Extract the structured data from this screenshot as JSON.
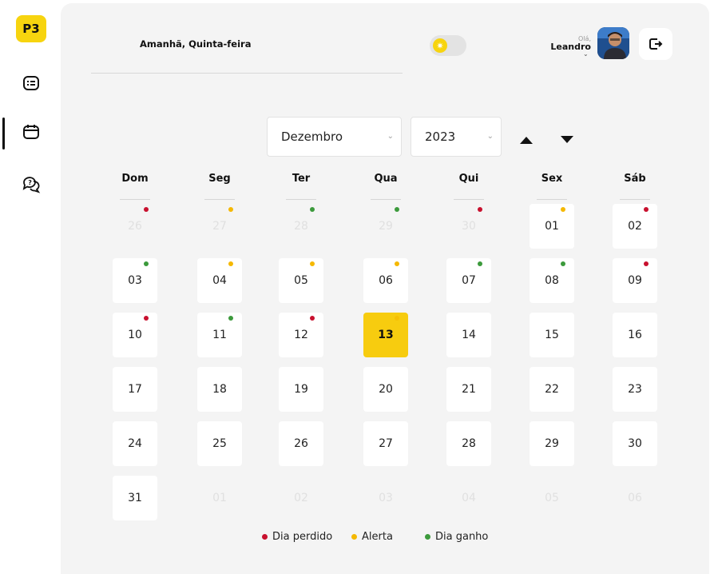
{
  "sidebar": {
    "logo": "P3",
    "items": [
      {
        "icon": "checklist-icon"
      },
      {
        "icon": "calendar-icon"
      },
      {
        "icon": "help-chat-icon"
      }
    ]
  },
  "header": {
    "date_label": "Amanhã, Quinta-feira",
    "greeting": "Olá,",
    "user_name": "Leandro"
  },
  "calendar": {
    "month": "Dezembro",
    "year": "2023",
    "weekdays": [
      "Dom",
      "Seg",
      "Ter",
      "Qua",
      "Qui",
      "Sex",
      "Sáb"
    ],
    "days": [
      {
        "label": "26",
        "other": true,
        "dot": "red"
      },
      {
        "label": "27",
        "other": true,
        "dot": "yellow"
      },
      {
        "label": "28",
        "other": true,
        "dot": "green"
      },
      {
        "label": "29",
        "other": true,
        "dot": "green"
      },
      {
        "label": "30",
        "other": true,
        "dot": "red"
      },
      {
        "label": "01",
        "other": false,
        "dot": "yellow"
      },
      {
        "label": "02",
        "other": false,
        "dot": "red"
      },
      {
        "label": "03",
        "other": false,
        "dot": "green"
      },
      {
        "label": "04",
        "other": false,
        "dot": "yellow"
      },
      {
        "label": "05",
        "other": false,
        "dot": "yellow"
      },
      {
        "label": "06",
        "other": false,
        "dot": "yellow"
      },
      {
        "label": "07",
        "other": false,
        "dot": "green"
      },
      {
        "label": "08",
        "other": false,
        "dot": "green"
      },
      {
        "label": "09",
        "other": false,
        "dot": "red"
      },
      {
        "label": "10",
        "other": false,
        "dot": "red"
      },
      {
        "label": "11",
        "other": false,
        "dot": "green"
      },
      {
        "label": "12",
        "other": false,
        "dot": "red"
      },
      {
        "label": "13",
        "other": false,
        "today": true,
        "dot": "yellow"
      },
      {
        "label": "14",
        "other": false
      },
      {
        "label": "15",
        "other": false
      },
      {
        "label": "16",
        "other": false
      },
      {
        "label": "17",
        "other": false
      },
      {
        "label": "18",
        "other": false
      },
      {
        "label": "19",
        "other": false
      },
      {
        "label": "20",
        "other": false
      },
      {
        "label": "21",
        "other": false
      },
      {
        "label": "22",
        "other": false
      },
      {
        "label": "23",
        "other": false
      },
      {
        "label": "24",
        "other": false
      },
      {
        "label": "25",
        "other": false
      },
      {
        "label": "26",
        "other": false
      },
      {
        "label": "27",
        "other": false
      },
      {
        "label": "28",
        "other": false
      },
      {
        "label": "29",
        "other": false
      },
      {
        "label": "30",
        "other": false
      },
      {
        "label": "31",
        "other": false
      },
      {
        "label": "01",
        "other": true
      },
      {
        "label": "02",
        "other": true
      },
      {
        "label": "03",
        "other": true
      },
      {
        "label": "04",
        "other": true
      },
      {
        "label": "05",
        "other": true
      },
      {
        "label": "06",
        "other": true
      }
    ]
  },
  "legend": [
    {
      "label": "Dia perdido",
      "color": "#c8102e"
    },
    {
      "label": "Alerta",
      "color": "#f5b800"
    },
    {
      "label": "Dia ganho",
      "color": "#3c9a3c"
    }
  ],
  "colors": {
    "accent": "#f7d40f",
    "today": "#f7cc0f",
    "red": "#c8102e",
    "yellow": "#f5b800",
    "green": "#3c9a3c"
  }
}
